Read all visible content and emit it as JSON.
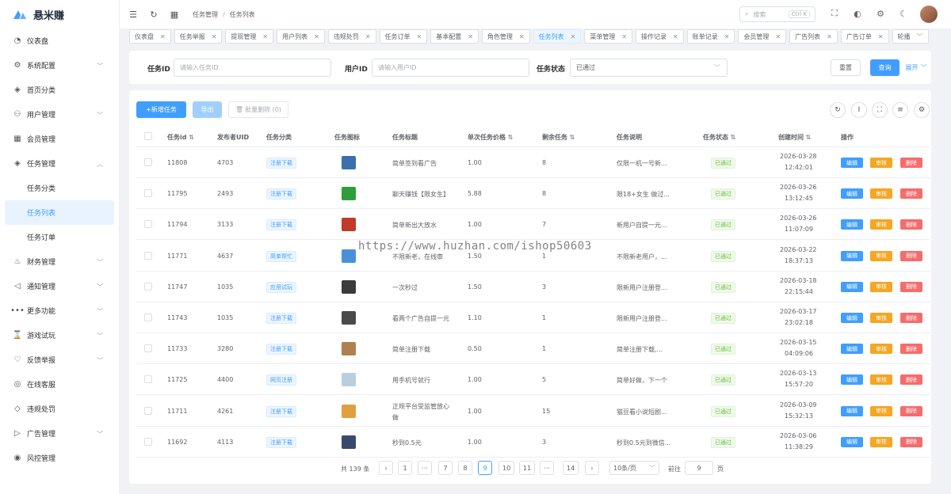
{
  "app": {
    "title": "悬米赚"
  },
  "sidebar": {
    "items": [
      {
        "label": "仪表盘",
        "icon": "dashboard-icon",
        "glyph": "◔",
        "chev": ""
      },
      {
        "label": "系统配置",
        "icon": "gear-icon",
        "glyph": "⚙",
        "chev": "﹀"
      },
      {
        "label": "首页分类",
        "icon": "layers-icon",
        "glyph": "◈",
        "chev": ""
      },
      {
        "label": "用户管理",
        "icon": "users-icon",
        "glyph": "⚇",
        "chev": "﹀"
      },
      {
        "label": "会员管理",
        "icon": "grid-icon",
        "glyph": "▦",
        "chev": ""
      },
      {
        "label": "任务管理",
        "icon": "layers-icon",
        "glyph": "◈",
        "chev": "︿"
      },
      {
        "label": "任务分类",
        "icon": "",
        "glyph": "",
        "chev": "",
        "sub": true
      },
      {
        "label": "任务列表",
        "icon": "",
        "glyph": "",
        "chev": "",
        "sub": true,
        "active": true
      },
      {
        "label": "任务订单",
        "icon": "",
        "glyph": "",
        "chev": "",
        "sub": true
      },
      {
        "label": "财务管理",
        "icon": "wallet-icon",
        "glyph": "♨",
        "chev": "﹀"
      },
      {
        "label": "通知管理",
        "icon": "speaker-icon",
        "glyph": "◁",
        "chev": "﹀"
      },
      {
        "label": "更多功能",
        "icon": "more-icon",
        "glyph": "•••",
        "chev": "﹀"
      },
      {
        "label": "游戏试玩",
        "icon": "hourglass-icon",
        "glyph": "⌛",
        "chev": "﹀"
      },
      {
        "label": "反馈举报",
        "icon": "heart-icon",
        "glyph": "♡",
        "chev": "﹀"
      },
      {
        "label": "在线客服",
        "icon": "chat-icon",
        "glyph": "◎",
        "chev": ""
      },
      {
        "label": "违规处罚",
        "icon": "tag-icon",
        "glyph": "◇",
        "chev": ""
      },
      {
        "label": "广告管理",
        "icon": "play-icon",
        "glyph": "▷",
        "chev": "﹀"
      },
      {
        "label": "风控管理",
        "icon": "shield-icon",
        "glyph": "◉",
        "chev": ""
      }
    ]
  },
  "header": {
    "breadcrumb": [
      "任务管理",
      "任务列表"
    ],
    "search_placeholder": "搜索",
    "search_kbd": "Ctrl K"
  },
  "tags": [
    {
      "label": "仪表盘"
    },
    {
      "label": "任务举报"
    },
    {
      "label": "提现管理"
    },
    {
      "label": "用户列表"
    },
    {
      "label": "违规处罚"
    },
    {
      "label": "任务订单"
    },
    {
      "label": "基本配置"
    },
    {
      "label": "角色管理"
    },
    {
      "label": "任务列表",
      "active": true
    },
    {
      "label": "菜单管理"
    },
    {
      "label": "操作记录"
    },
    {
      "label": "账单记录"
    },
    {
      "label": "会员管理"
    },
    {
      "label": "广告列表"
    },
    {
      "label": "广告订单"
    },
    {
      "label": "轮播"
    }
  ],
  "filters": {
    "task_id_label": "任务ID",
    "task_id_placeholder": "请输入任务ID",
    "user_id_label": "用户ID",
    "user_id_placeholder": "请输入用户ID",
    "status_label": "任务状态",
    "status_value": "已通过",
    "reset": "重置",
    "query": "查询",
    "expand": "展开"
  },
  "toolbar": {
    "add": "+新增任务",
    "export": "导出",
    "batch_delete": "批量删除 (0)"
  },
  "table": {
    "columns": [
      "任务id",
      "发布者UID",
      "任务分类",
      "任务图标",
      "任务标题",
      "单次任务价格",
      "剩余任务",
      "任务说明",
      "任务状态",
      "创建时间",
      "操作"
    ],
    "actions": {
      "edit": "编辑",
      "review": "审核",
      "delete": "删除"
    },
    "rows": [
      {
        "id": "11808",
        "uid": "4703",
        "cat": "注册下载",
        "title": "简单签到看广告",
        "price": "1.00",
        "remain": "8",
        "desc": "仅限一机一号新...",
        "status": "已通过",
        "date": "2026-03-28",
        "time": "12:42:01",
        "icon": "#3a6fb0"
      },
      {
        "id": "11795",
        "uid": "2493",
        "cat": "注册下载",
        "title": "聊天赚钱【限女生】",
        "price": "5.88",
        "remain": "8",
        "desc": "限18+女生 做过...",
        "status": "已通过",
        "date": "2026-03-26",
        "time": "13:12:45",
        "icon": "#2e9e3a"
      },
      {
        "id": "11794",
        "uid": "3133",
        "cat": "注册下载",
        "title": "简单新出大放水",
        "price": "1.00",
        "remain": "7",
        "desc": "新用户自提一元...",
        "status": "已通过",
        "date": "2026-03-26",
        "time": "11:07:09",
        "icon": "#c0392b"
      },
      {
        "id": "11771",
        "uid": "4637",
        "cat": "简单帮忙",
        "title": "不限新老，在线审",
        "price": "1.50",
        "remain": "1",
        "desc": "不限新老用户，...",
        "status": "已通过",
        "date": "2026-03-22",
        "time": "18:37:13",
        "icon": "#4a90d9"
      },
      {
        "id": "11747",
        "uid": "1035",
        "cat": "应用试玩",
        "title": "一次秒过",
        "price": "1.50",
        "remain": "3",
        "desc": "限新用户注册登...",
        "status": "已通过",
        "date": "2026-03-18",
        "time": "22:15:44",
        "icon": "#3b3b3b"
      },
      {
        "id": "11743",
        "uid": "1035",
        "cat": "注册下载",
        "title": "看两个广告自提一元",
        "price": "1.10",
        "remain": "1",
        "desc": "限新用户注册登...",
        "status": "已通过",
        "date": "2026-03-17",
        "time": "23:02:18",
        "icon": "#4a4a4a"
      },
      {
        "id": "11733",
        "uid": "3280",
        "cat": "注册下载",
        "title": "简单注册下载",
        "price": "0.50",
        "remain": "1",
        "desc": "简单注册下载,...",
        "status": "已通过",
        "date": "2026-03-15",
        "time": "04:09:06",
        "icon": "#b08050"
      },
      {
        "id": "11725",
        "uid": "4400",
        "cat": "网页注册",
        "title": "用手机号就行",
        "price": "1.00",
        "remain": "5",
        "desc": "简单好做，下一个",
        "status": "已通过",
        "date": "2026-03-13",
        "time": "15:57:20",
        "icon": "#b9cfe0"
      },
      {
        "id": "11711",
        "uid": "4261",
        "cat": "注册下载",
        "title": "正规平台受监管放心",
        "title2": "做",
        "price": "1.00",
        "remain": "15",
        "desc": "猫豆看小说短剧...",
        "status": "已通过",
        "date": "2026-03-09",
        "time": "15:32:13",
        "icon": "#e0a040"
      },
      {
        "id": "11692",
        "uid": "4113",
        "cat": "注册下载",
        "title": "秒到0.5元",
        "price": "1.00",
        "remain": "3",
        "desc": "秒到0.5元到微信...",
        "status": "已通过",
        "date": "2026-03-06",
        "time": "11:38:29",
        "icon": "#3a4a6a"
      }
    ]
  },
  "pagination": {
    "total": "共 139 条",
    "pages": [
      "1",
      "···",
      "7",
      "8",
      "9",
      "10",
      "11",
      "···",
      "14"
    ],
    "current": "9",
    "page_size": "10条/页",
    "goto_label": "前往",
    "goto_value": "9",
    "page_suffix": "页"
  },
  "watermark": "https://www.huzhan.com/ishop50603",
  "colors": {
    "primary": "#409eff",
    "warning": "#f5a623",
    "danger": "#f56c6c",
    "success": "#67c23a"
  }
}
